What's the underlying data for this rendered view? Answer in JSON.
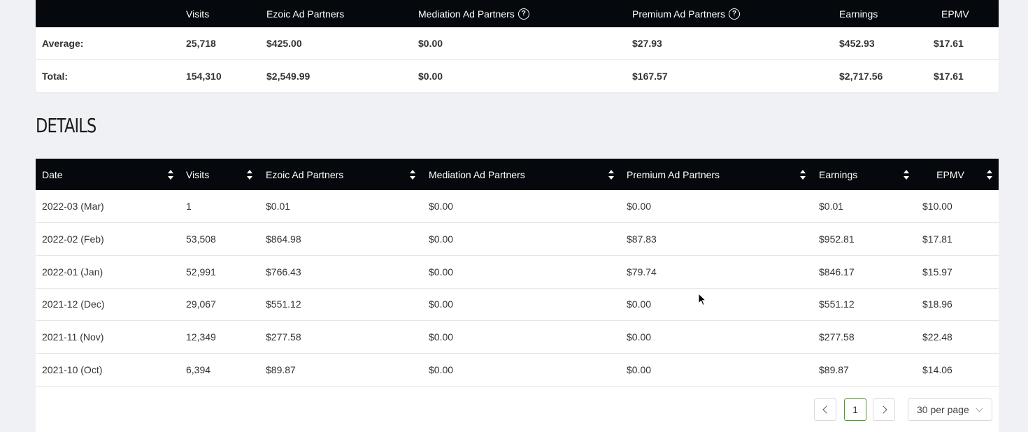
{
  "summary": {
    "headers": [
      "",
      "Visits",
      "Ezoic Ad Partners",
      "Mediation Ad Partners",
      "Premium Ad Partners",
      "Earnings",
      "EPMV"
    ],
    "help_glyph": "?",
    "average": {
      "label": "Average:",
      "visits": "25,718",
      "ezoic": "$425.00",
      "mediation": "$0.00",
      "premium": "$27.93",
      "earnings": "$452.93",
      "epmv": "$17.61"
    },
    "total": {
      "label": "Total:",
      "visits": "154,310",
      "ezoic": "$2,549.99",
      "mediation": "$0.00",
      "premium": "$167.57",
      "earnings": "$2,717.56",
      "epmv": "$17.61"
    }
  },
  "details": {
    "title": "DETAILS",
    "headers": [
      "Date",
      "Visits",
      "Ezoic Ad Partners",
      "Mediation Ad Partners",
      "Premium Ad Partners",
      "Earnings",
      "EPMV"
    ],
    "rows": [
      [
        "2022-03 (Mar)",
        "1",
        "$0.01",
        "$0.00",
        "$0.00",
        "$0.01",
        "$10.00"
      ],
      [
        "2022-02 (Feb)",
        "53,508",
        "$864.98",
        "$0.00",
        "$87.83",
        "$952.81",
        "$17.81"
      ],
      [
        "2022-01 (Jan)",
        "52,991",
        "$766.43",
        "$0.00",
        "$79.74",
        "$846.17",
        "$15.97"
      ],
      [
        "2021-12 (Dec)",
        "29,067",
        "$551.12",
        "$0.00",
        "$0.00",
        "$551.12",
        "$18.96"
      ],
      [
        "2021-11 (Nov)",
        "12,349",
        "$277.58",
        "$0.00",
        "$0.00",
        "$277.58",
        "$22.48"
      ],
      [
        "2021-10 (Oct)",
        "6,394",
        "$89.87",
        "$0.00",
        "$0.00",
        "$89.87",
        "$14.06"
      ]
    ]
  },
  "pagination": {
    "current_page": "1",
    "per_page": "30 per page",
    "prev_icon": "chevron-left-icon",
    "next_icon": "chevron-right-icon"
  },
  "colors": {
    "header_bg": "#05080c",
    "page_bg": "#f0f1f4",
    "active_page_border": "#4c9a2a"
  }
}
